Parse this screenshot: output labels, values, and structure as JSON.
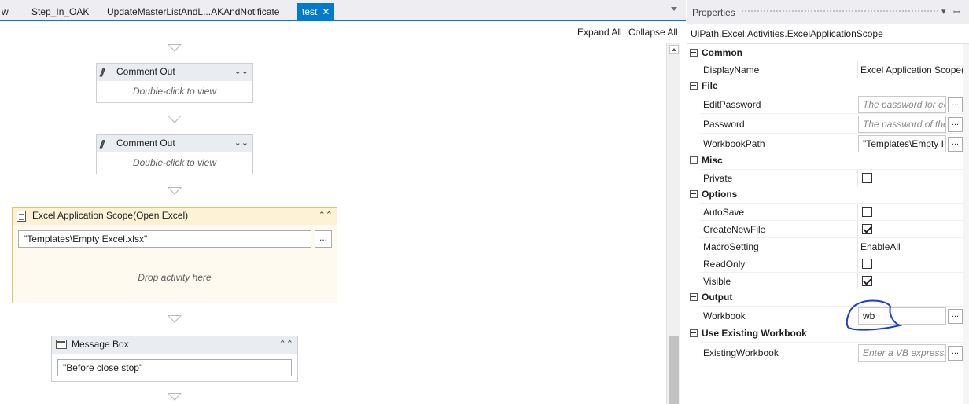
{
  "tabs": [
    {
      "label": "w"
    },
    {
      "label": "Step_In_OAK"
    },
    {
      "label": "UpdateMasterListAndL...AKAndNotificate"
    },
    {
      "label": "test",
      "active": true
    }
  ],
  "toolbar": {
    "expand_all": "Expand All",
    "collapse_all": "Collapse All"
  },
  "activities": {
    "comment1": {
      "title": "Comment Out",
      "body": "Double-click to view"
    },
    "comment2": {
      "title": "Comment Out",
      "body": "Double-click to view"
    },
    "excel_scope": {
      "title": "Excel Application Scope(Open Excel)",
      "path": "\"Templates\\Empty Excel.xlsx\"",
      "dots": "...",
      "drop": "Drop activity here"
    },
    "message_box": {
      "title": "Message Box",
      "text": "\"Before close stop\""
    }
  },
  "properties": {
    "title": "Properties",
    "type_name": "UiPath.Excel.Activities.ExcelApplicationScope",
    "categories": {
      "common": "Common",
      "file": "File",
      "misc": "Misc",
      "options": "Options",
      "output": "Output",
      "existing": "Use Existing Workbook"
    },
    "rows": {
      "display_name": {
        "name": "DisplayName",
        "value": "Excel Application Scope("
      },
      "edit_password": {
        "name": "EditPassword",
        "placeholder": "The password for ec"
      },
      "password": {
        "name": "Password",
        "placeholder": "The password of the"
      },
      "workbook_path": {
        "name": "WorkbookPath",
        "value": "\"Templates\\Empty I"
      },
      "private": {
        "name": "Private",
        "checked": false
      },
      "autosave": {
        "name": "AutoSave",
        "checked": false
      },
      "create_new_file": {
        "name": "CreateNewFile",
        "checked": true
      },
      "macro_setting": {
        "name": "MacroSetting",
        "value": "EnableAll"
      },
      "read_only": {
        "name": "ReadOnly",
        "checked": false
      },
      "visible": {
        "name": "Visible",
        "checked": true
      },
      "workbook": {
        "name": "Workbook",
        "value": "wb"
      },
      "existing_workbook": {
        "name": "ExistingWorkbook",
        "placeholder": "Enter a VB expressic"
      }
    },
    "dots": "..."
  },
  "colors": {
    "accent": "#007acc",
    "selected_border": "#e7c26a",
    "annotation": "#1f3bd6"
  }
}
